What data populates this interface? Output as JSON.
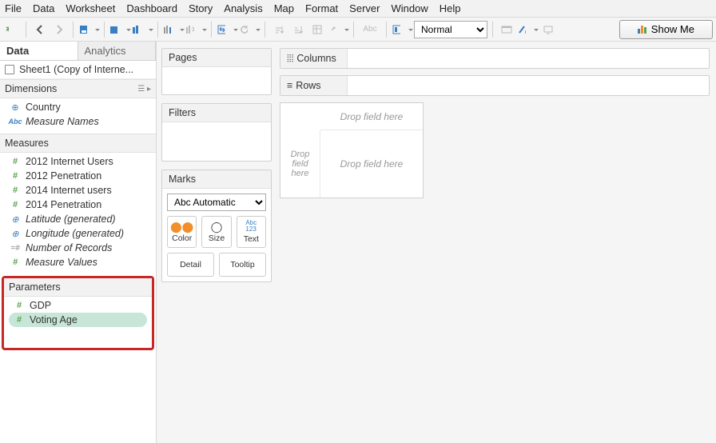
{
  "menu": [
    "File",
    "Data",
    "Worksheet",
    "Dashboard",
    "Story",
    "Analysis",
    "Map",
    "Format",
    "Server",
    "Window",
    "Help"
  ],
  "toolbar": {
    "fit_mode": "Normal",
    "show_me": "Show Me"
  },
  "sidebar": {
    "tabs": {
      "data": "Data",
      "analytics": "Analytics"
    },
    "datasource": "Sheet1 (Copy of Interne...",
    "sections": {
      "dimensions": {
        "title": "Dimensions",
        "items": [
          {
            "icon": "globe",
            "label": "Country"
          },
          {
            "icon": "abc",
            "label": "Measure Names",
            "italic": true
          }
        ]
      },
      "measures": {
        "title": "Measures",
        "items": [
          {
            "icon": "hash",
            "label": "2012 Internet Users"
          },
          {
            "icon": "hash",
            "label": "2012 Penetration"
          },
          {
            "icon": "hash",
            "label": "2014 Internet users"
          },
          {
            "icon": "hash",
            "label": "2014 Penetration"
          },
          {
            "icon": "globe",
            "label": "Latitude (generated)",
            "italic": true
          },
          {
            "icon": "globe",
            "label": "Longitude (generated)",
            "italic": true
          },
          {
            "icon": "calc",
            "label": "Number of Records",
            "italic": true
          },
          {
            "icon": "hash",
            "label": "Measure Values",
            "italic": true
          }
        ]
      },
      "parameters": {
        "title": "Parameters",
        "items": [
          {
            "icon": "hash",
            "label": "GDP"
          },
          {
            "icon": "hash",
            "label": "Voting Age",
            "selected": true
          }
        ]
      }
    }
  },
  "cards": {
    "pages": "Pages",
    "filters": "Filters",
    "marks": {
      "title": "Marks",
      "type": "Automatic",
      "buttons": {
        "color": "Color",
        "size": "Size",
        "text": "Text",
        "detail": "Detail",
        "tooltip": "Tooltip"
      }
    }
  },
  "shelves": {
    "columns": "Columns",
    "rows": "Rows"
  },
  "viz": {
    "top": "Drop field here",
    "left": "Drop field here",
    "main": "Drop field here"
  }
}
